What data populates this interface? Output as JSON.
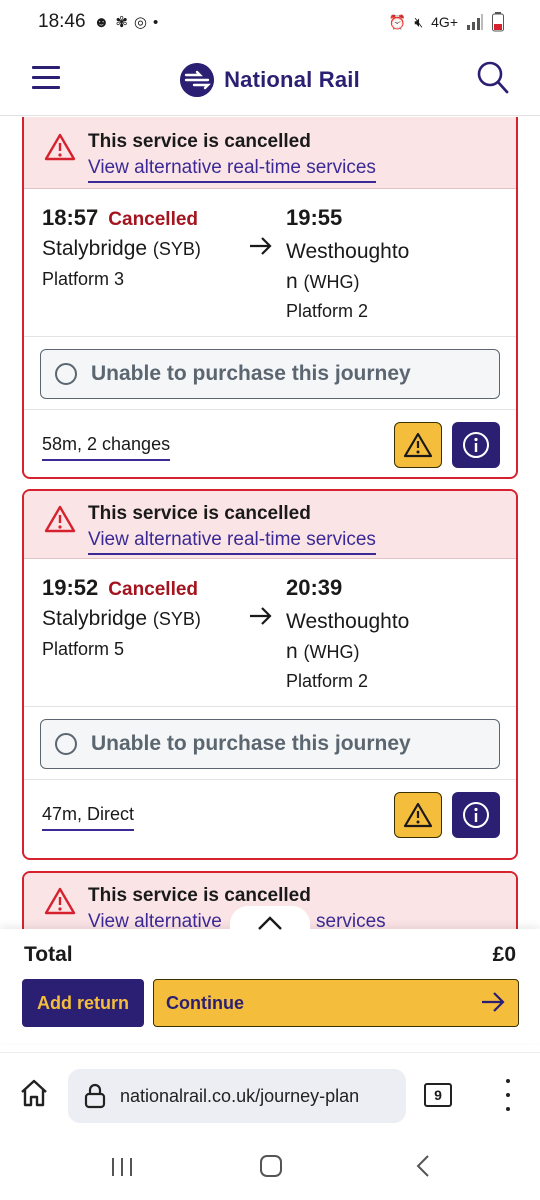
{
  "status_bar": {
    "time": "18:46",
    "network": "4G+"
  },
  "header": {
    "brand": "National Rail"
  },
  "journeys": [
    {
      "alert_title": "This service is cancelled",
      "alert_link": "View alternative real-time services",
      "depart_time": "18:57",
      "status": "Cancelled",
      "origin": "Stalybridge",
      "origin_code": "(SYB)",
      "origin_platform": "Platform 3",
      "arrive_time": "19:55",
      "destination_line1": "Westhoughto",
      "destination_line2": "n",
      "destination_code": "(WHG)",
      "destination_platform": "Platform 2",
      "purchase_label": "Unable to purchase this journey",
      "summary": "58m, 2 changes"
    },
    {
      "alert_title": "This service is cancelled",
      "alert_link": "View alternative real-time services",
      "depart_time": "19:52",
      "status": "Cancelled",
      "origin": "Stalybridge",
      "origin_code": "(SYB)",
      "origin_platform": "Platform 5",
      "arrive_time": "20:39",
      "destination_line1": "Westhoughto",
      "destination_line2": "n",
      "destination_code": "(WHG)",
      "destination_platform": "Platform 2",
      "purchase_label": "Unable to purchase this journey",
      "summary": "47m, Direct"
    },
    {
      "alert_title": "This service is cancelled",
      "alert_link_left": "View alternative",
      "alert_link_right": "services"
    }
  ],
  "footer": {
    "total_label": "Total",
    "total_value": "£0",
    "add_return": "Add return",
    "continue": "Continue"
  },
  "browser": {
    "url": "nationalrail.co.uk/journey-plan",
    "tab_count": "9"
  },
  "colors": {
    "brand": "#2b1f73",
    "accent": "#f5bd3c",
    "alert": "#d5222e",
    "cancelled": "#a3141f"
  }
}
